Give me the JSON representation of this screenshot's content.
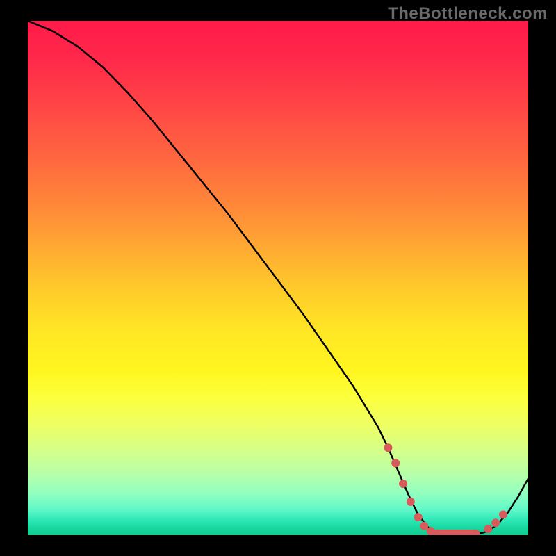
{
  "watermark": "TheBottleneck.com",
  "chart_data": {
    "type": "line",
    "title": "",
    "xlabel": "",
    "ylabel": "",
    "x_range": [
      0,
      100
    ],
    "y_range": [
      0,
      100
    ],
    "curve": {
      "x": [
        0,
        5,
        10,
        15,
        20,
        25,
        30,
        35,
        40,
        45,
        50,
        55,
        60,
        65,
        70,
        72,
        74,
        76,
        78,
        80,
        82,
        84,
        86,
        88,
        90,
        92,
        94,
        96,
        98,
        100
      ],
      "y": [
        100,
        98,
        95,
        91,
        86,
        80.5,
        74.5,
        68.5,
        62.5,
        56,
        49.5,
        43,
        36,
        29,
        21,
        17,
        12.5,
        8,
        4,
        1.5,
        0.3,
        0,
        0,
        0,
        0.2,
        0.8,
        2.2,
        4.5,
        7.5,
        11
      ]
    },
    "dots": [
      {
        "x": 72,
        "y": 17
      },
      {
        "x": 73.5,
        "y": 14
      },
      {
        "x": 75,
        "y": 10
      },
      {
        "x": 76.5,
        "y": 6.5
      },
      {
        "x": 78,
        "y": 3.5
      },
      {
        "x": 79.2,
        "y": 1.8
      },
      {
        "x": 80.5,
        "y": 0.8
      },
      {
        "x": 81,
        "y": 0.3
      },
      {
        "x": 81.8,
        "y": 0.3
      },
      {
        "x": 82.5,
        "y": 0.3
      },
      {
        "x": 83.2,
        "y": 0.3
      },
      {
        "x": 83.9,
        "y": 0.3
      },
      {
        "x": 84.6,
        "y": 0.3
      },
      {
        "x": 85.3,
        "y": 0.3
      },
      {
        "x": 86.0,
        "y": 0.3
      },
      {
        "x": 86.7,
        "y": 0.3
      },
      {
        "x": 87.4,
        "y": 0.3
      },
      {
        "x": 88.1,
        "y": 0.3
      },
      {
        "x": 88.8,
        "y": 0.3
      },
      {
        "x": 89.5,
        "y": 0.3
      },
      {
        "x": 92,
        "y": 1.2
      },
      {
        "x": 93.5,
        "y": 2.4
      },
      {
        "x": 95,
        "y": 4.0
      }
    ],
    "background_gradient": {
      "top_color": "#ff1a4a",
      "mid_color": "#ffe824",
      "bottom_color": "#10cc90"
    }
  }
}
